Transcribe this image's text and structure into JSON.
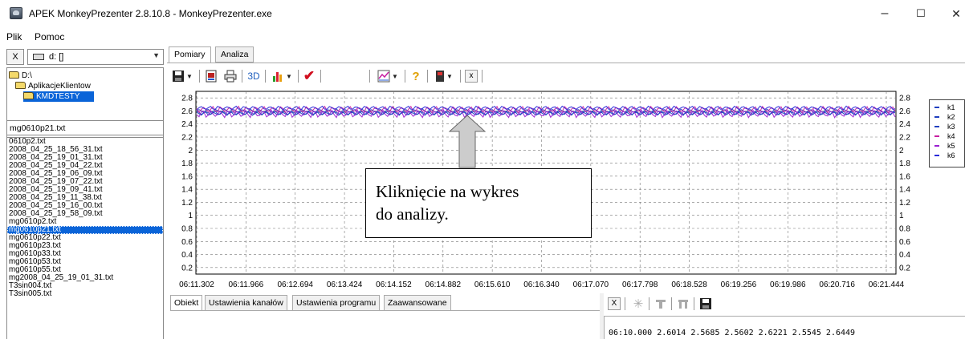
{
  "window": {
    "title": "APEK MonkeyPrezenter 2.8.10.8 - MonkeyPrezenter.exe",
    "minimize": "–",
    "maximize": "☐",
    "close": "✕"
  },
  "menu": [
    "Plik",
    "Pomoc"
  ],
  "left": {
    "close_label": "X",
    "drive_value": "d: []",
    "dirs": [
      "D:\\",
      "AplikacjeKlientow",
      "KMDTESTY"
    ],
    "selected_file": "mg0610p21.txt",
    "files": [
      "0610p2.txt",
      "2008_04_25_18_56_31.txt",
      "2008_04_25_19_01_31.txt",
      "2008_04_25_19_04_22.txt",
      "2008_04_25_19_06_09.txt",
      "2008_04_25_19_07_22.txt",
      "2008_04_25_19_09_41.txt",
      "2008_04_25_19_11_38.txt",
      "2008_04_25_19_16_00.txt",
      "2008_04_25_19_58_09.txt",
      "mg0610p2.txt",
      "mg0610p21.txt",
      "mg0610p22.txt",
      "mg0610p23.txt",
      "mg0610p33.txt",
      "mg0610p53.txt",
      "mg0610p55.txt",
      "mg2008_04_25_19_01_31.txt",
      "T3sin004.txt",
      "T3sin005.txt"
    ]
  },
  "tabs": [
    "Pomiary",
    "Analiza"
  ],
  "toolbar": {
    "btn_3d": "3D",
    "btn_x": "x",
    "help_glyph": "?",
    "check_glyph": "✔"
  },
  "chart_data": {
    "type": "line",
    "x_ticks": [
      "06:11.302",
      "06:11.966",
      "06:12.694",
      "06:13.424",
      "06:14.152",
      "06:14.882",
      "06:15.610",
      "06:16.340",
      "06:17.070",
      "06:17.798",
      "06:18.528",
      "06:19.256",
      "06:19.986",
      "06:20.716",
      "06:21.444"
    ],
    "y_ticks": [
      "0.2",
      "0.4",
      "0.6",
      "0.8",
      "1",
      "1.2",
      "1.4",
      "1.6",
      "1.8",
      "2",
      "2.2",
      "2.4",
      "2.6",
      "2.8"
    ],
    "ylim": [
      0.1,
      2.9
    ],
    "grid": true,
    "legend_position": "right",
    "series": [
      {
        "name": "k1",
        "color": "#1f3fbf",
        "center": 2.601,
        "amp": 0.03
      },
      {
        "name": "k2",
        "color": "#1f3fbf",
        "center": 2.569,
        "amp": 0.03
      },
      {
        "name": "k3",
        "color": "#1f3fbf",
        "center": 2.56,
        "amp": 0.03
      },
      {
        "name": "k4",
        "color": "#c81ea0",
        "center": 2.622,
        "amp": 0.05
      },
      {
        "name": "k5",
        "color": "#9b1fd1",
        "center": 2.555,
        "amp": 0.06
      },
      {
        "name": "k6",
        "color": "#2a2ad9",
        "center": 2.645,
        "amp": 0.03
      }
    ]
  },
  "callout": {
    "line1": "Kliknięcie na wykres",
    "line2": "do analizy."
  },
  "bottom_tabs": [
    "Obiekt",
    "Ustawienia kanałów",
    "Ustawienia programu",
    "Zaawansowane"
  ],
  "bottom_toolbar": {
    "x_label": "X"
  },
  "console": {
    "line": "06:10.000 2.6014 2.5685 2.5602 2.6221 2.5545 2.6449"
  }
}
